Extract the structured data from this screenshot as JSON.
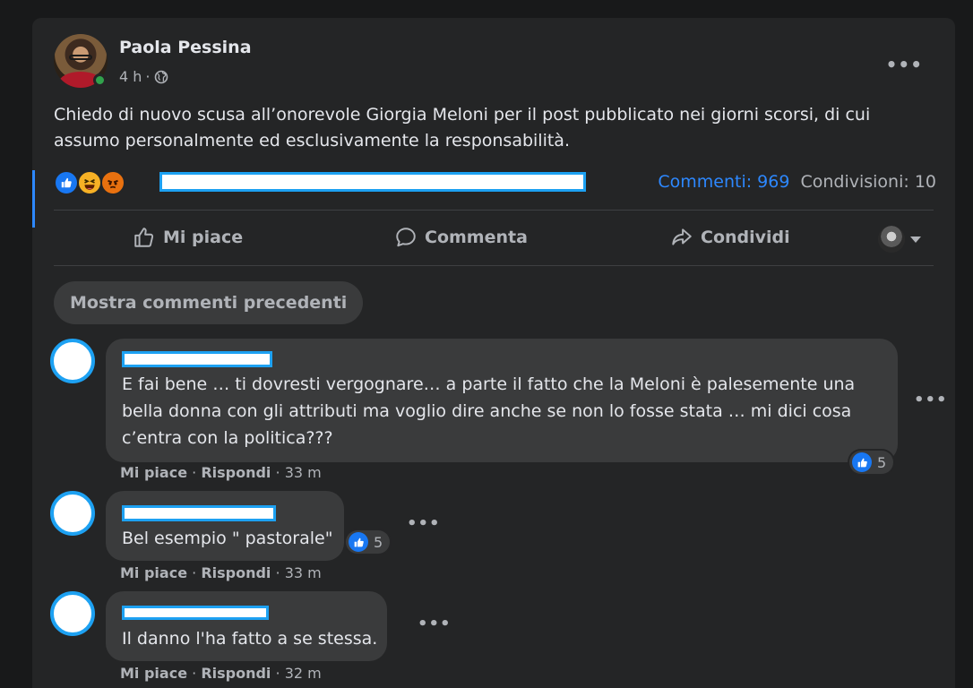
{
  "post": {
    "author": "Paola Pessina",
    "time": "4 h",
    "separator": "·",
    "text": "Chiedo di nuovo scusa all’onorevole Giorgia Meloni per il post pubblicato nei giorni scorsi, di cui assumo personalmente ed esclusivamente la responsabilità.",
    "more_icon": "more-horizontal-icon",
    "privacy_icon": "globe-icon"
  },
  "stats": {
    "reaction_types": [
      "like",
      "haha",
      "angry"
    ],
    "comments": "Commenti: 969",
    "shares": "Condivisioni: 10"
  },
  "actions": {
    "like": "Mi piace",
    "comment": "Commenta",
    "share": "Condividi"
  },
  "show_previous": "Mostra commenti precedenti",
  "comments": [
    {
      "text": "E fai bene … ti dovresti vergognare… a parte il fatto che la Meloni è palesemente una bella donna con gli attributi ma voglio dire anche se non lo fosse stata … mi dici cosa c’entra con la politica???",
      "reactions": "5",
      "like": "Mi piace",
      "reply": "Rispondi",
      "time": "33 m"
    },
    {
      "text": "Bel esempio \" pastorale\"",
      "reactions": "5",
      "like": "Mi piace",
      "reply": "Rispondi",
      "time": "33 m"
    },
    {
      "text": "Il danno l'ha fatto a se stessa.",
      "reactions": "",
      "like": "Mi piace",
      "reply": "Rispondi",
      "time": "32 m"
    }
  ],
  "colors": {
    "accent": "#2d88ff",
    "redaction_border": "#1da1f2",
    "background": "#18191a",
    "card": "#242526"
  }
}
